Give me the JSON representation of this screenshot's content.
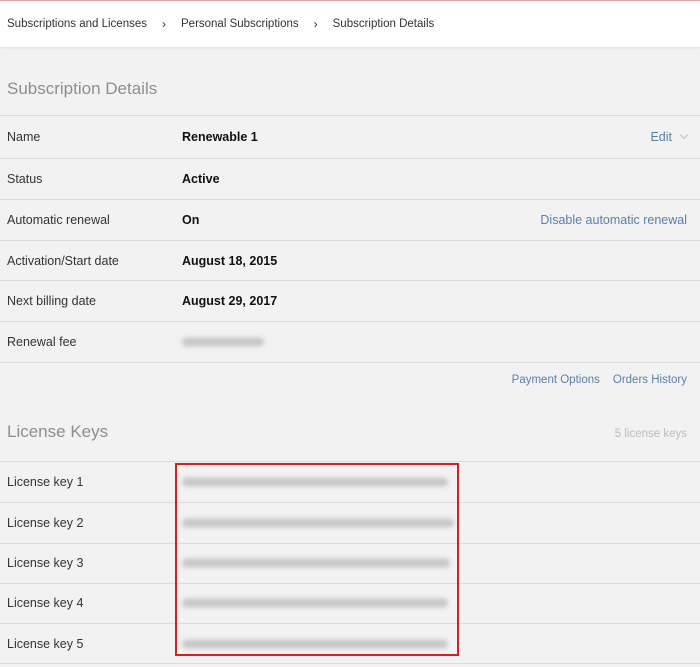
{
  "breadcrumb": {
    "items": [
      "Subscriptions and Licenses",
      "Personal Subscriptions",
      "Subscription Details"
    ],
    "separator": "›"
  },
  "details": {
    "title": "Subscription Details",
    "rows": [
      {
        "label": "Name",
        "value": "Renewable 1",
        "action": "Edit"
      },
      {
        "label": "Status",
        "value": "Active"
      },
      {
        "label": "Automatic renewal",
        "value": "On",
        "action": "Disable automatic renewal"
      },
      {
        "label": "Activation/Start date",
        "value": "August 18, 2015"
      },
      {
        "label": "Next billing date",
        "value": "August 29, 2017"
      },
      {
        "label": "Renewal fee",
        "value": ""
      }
    ],
    "links": {
      "payment_options": "Payment Options",
      "orders_history": "Orders History"
    }
  },
  "license_keys": {
    "title": "License Keys",
    "count": "5 license keys",
    "rows": [
      {
        "label": "License key 1"
      },
      {
        "label": "License key 2"
      },
      {
        "label": "License key 3"
      },
      {
        "label": "License key 4"
      },
      {
        "label": "License key 5"
      }
    ]
  },
  "colors": {
    "link": "#5b7fa8",
    "highlight": "#d31f26",
    "background": "#f2f2f2",
    "divider": "#dcdcdc"
  }
}
